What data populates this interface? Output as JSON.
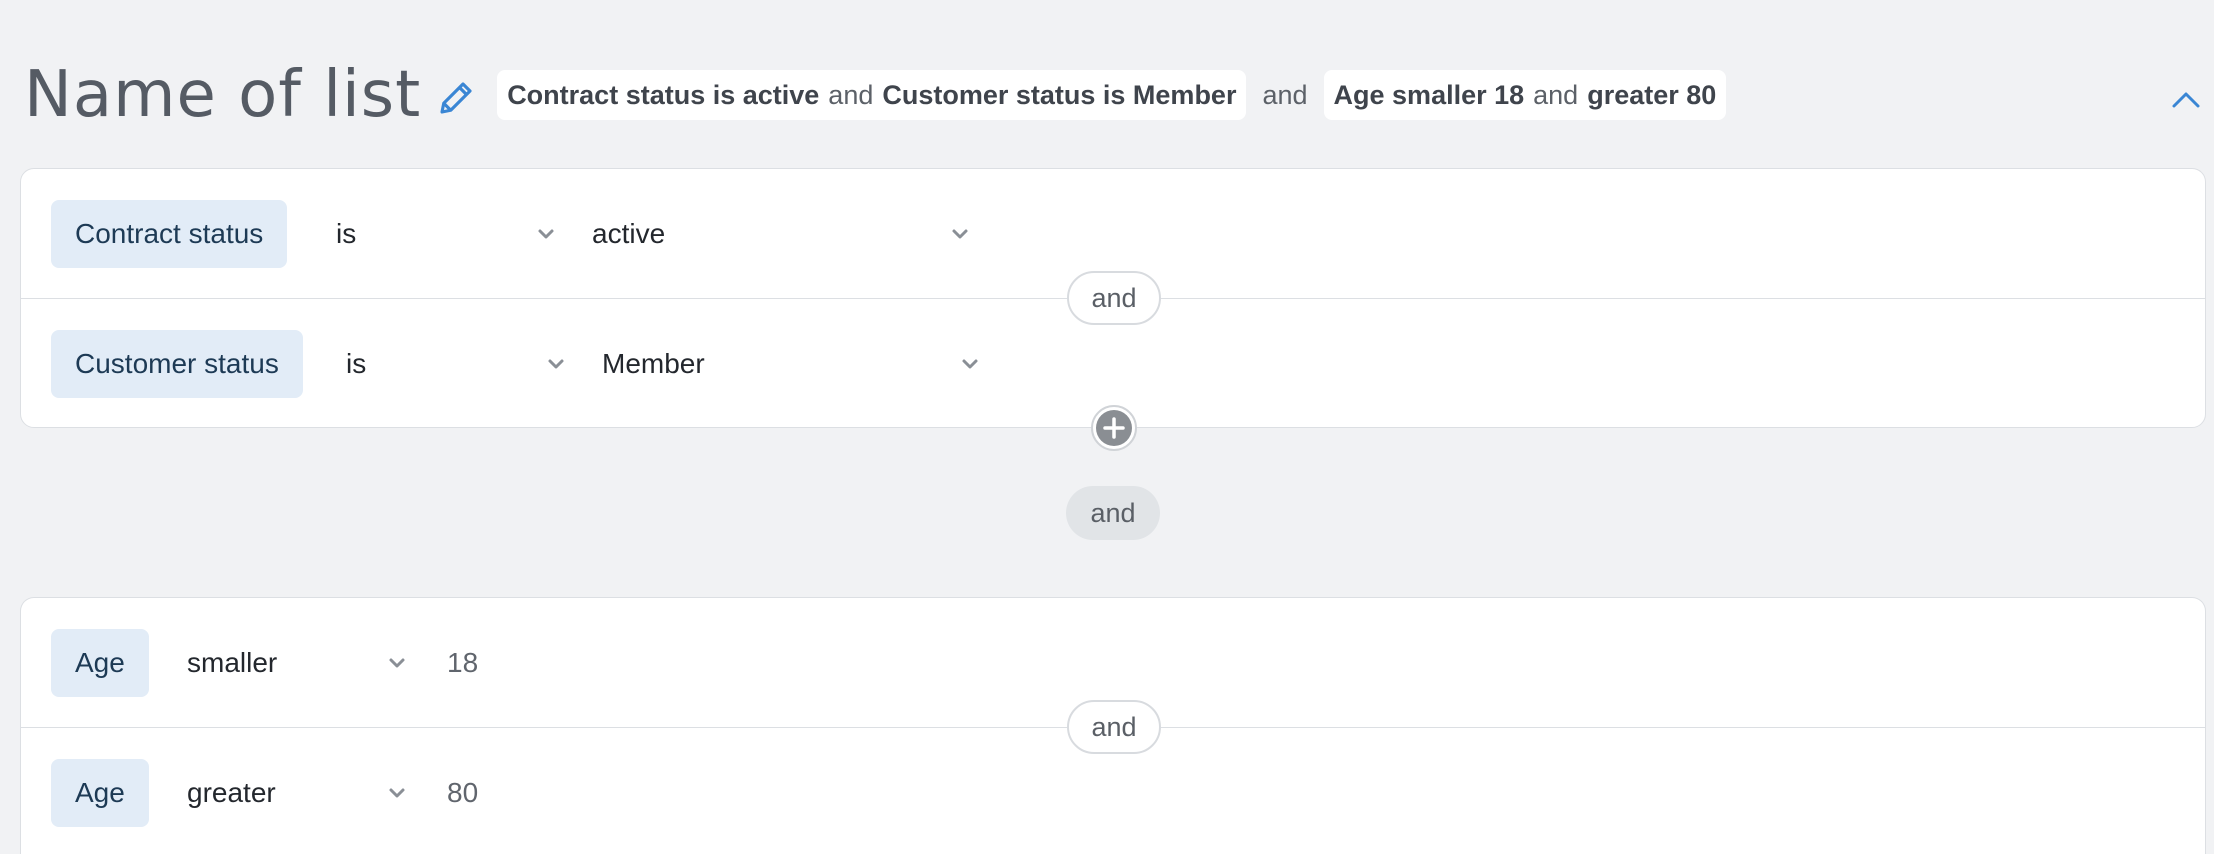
{
  "header": {
    "title": "Name of list",
    "summary": {
      "chip1": {
        "part1": "Contract status is active",
        "conj": "and",
        "part2": "Customer status is Member"
      },
      "between": "and",
      "chip2": {
        "part1": "Age smaller 18",
        "conj": "and",
        "part2": "greater 80"
      }
    }
  },
  "groups": [
    {
      "rows": [
        {
          "field": "Contract status",
          "operator": "is",
          "value": "active"
        },
        {
          "field": "Customer status",
          "operator": "is",
          "value": "Member"
        }
      ],
      "row_connector": "and"
    },
    {
      "rows": [
        {
          "field": "Age",
          "operator": "smaller",
          "value": "18"
        },
        {
          "field": "Age",
          "operator": "greater",
          "value": "80"
        }
      ],
      "row_connector": "and"
    }
  ],
  "group_connector": "and",
  "colors": {
    "accent": "#3a86d4",
    "chip_bg": "#e2ecf7",
    "chip_text": "#1d3a55",
    "page_bg": "#f1f2f4"
  },
  "icons": {
    "edit": "pencil-icon",
    "collapse": "chevron-up-icon",
    "dropdown": "chevron-down-icon",
    "add": "plus-circle-icon"
  }
}
